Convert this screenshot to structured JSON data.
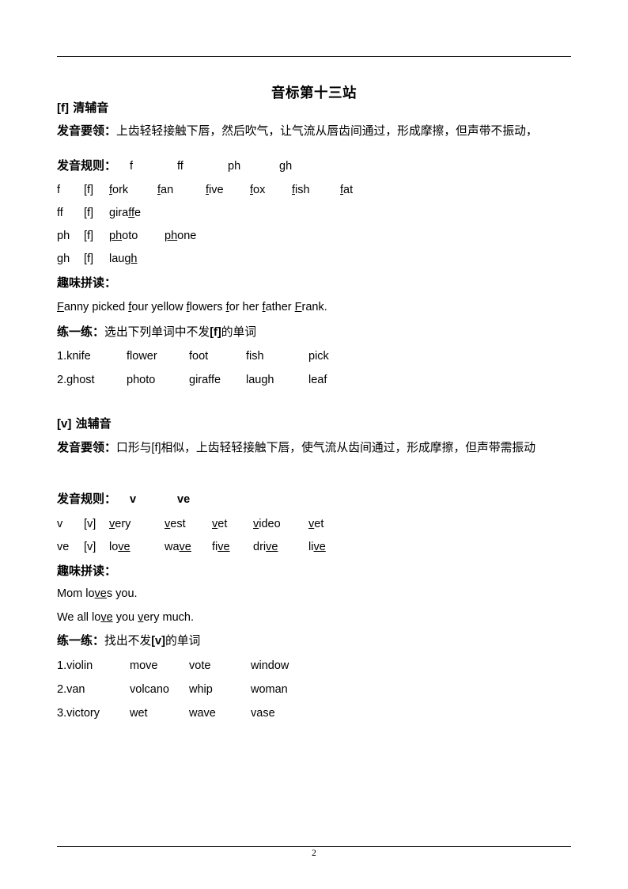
{
  "document": {
    "title": "音标第十三站",
    "page_number": "2"
  },
  "sections": [
    {
      "id": "f-section",
      "heading_ipa": "[f]",
      "heading_label": "清辅音",
      "key_label": "发音要领：",
      "key_text": "上齿轻轻接触下唇，然后吹气，让气流从唇齿间通过，形成摩擦，但声带不振动，",
      "rules_label": "发音规则：",
      "rule_letters": [
        "f",
        "ff",
        "ph",
        "gh"
      ],
      "word_rows": [
        {
          "spelling": "f",
          "ipa": "[f]",
          "words": [
            {
              "pre": "",
              "mark": "f",
              "post": "ork"
            },
            {
              "pre": "",
              "mark": "f",
              "post": "an"
            },
            {
              "pre": "",
              "mark": "f",
              "post": "ive"
            },
            {
              "pre": "",
              "mark": "f",
              "post": "ox"
            },
            {
              "pre": "",
              "mark": "f",
              "post": "ish"
            },
            {
              "pre": "",
              "mark": "f",
              "post": "at"
            }
          ]
        },
        {
          "spelling": "ff",
          "ipa": "[f]",
          "words": [
            {
              "pre": "gira",
              "mark": "ff",
              "post": "e"
            }
          ]
        },
        {
          "spelling": "ph",
          "ipa": "[f]",
          "words": [
            {
              "pre": "",
              "mark": "ph",
              "post": "oto"
            },
            {
              "pre": "",
              "mark": "ph",
              "post": "one"
            }
          ]
        },
        {
          "spelling": "gh",
          "ipa": "[f]",
          "words": [
            {
              "pre": "lau",
              "mark": "gh",
              "post": ""
            }
          ]
        }
      ],
      "fun_label": "趣味拼读：",
      "sentences": [
        [
          {
            "mark": "F",
            "post": "anny "
          },
          {
            "mark": "",
            "post": "picked "
          },
          {
            "mark": "f",
            "post": "our "
          },
          {
            "mark": "",
            "post": "yellow "
          },
          {
            "mark": "f",
            "post": "lowers "
          },
          {
            "mark": "f",
            "post": "or "
          },
          {
            "mark": "",
            "post": "her "
          },
          {
            "mark": "f",
            "post": "ather "
          },
          {
            "mark": "F",
            "post": "rank."
          }
        ]
      ],
      "practice_label": "练一练：",
      "practice_prompt_pre": "选出下列单词中不发",
      "practice_prompt_ipa": "[f]",
      "practice_prompt_post": "的单词",
      "practice_rows": [
        [
          "1.knife",
          "flower",
          "foot",
          "fish",
          "pick"
        ],
        [
          "2.ghost",
          "photo",
          "giraffe",
          "laugh",
          "leaf"
        ]
      ]
    },
    {
      "id": "v-section",
      "heading_ipa": "[v]",
      "heading_label": "浊辅音",
      "key_label": "发音要领：",
      "key_text_pre": "口形与",
      "key_text_ipa": "[f]",
      "key_text_post": "相似，上齿轻轻接触下唇，使气流从齿间通过，形成摩擦，但声带需振动",
      "rules_label": "发音规则：",
      "rule_letters": [
        "v",
        "ve"
      ],
      "word_rows": [
        {
          "spelling": "v",
          "ipa": "[v]",
          "words": [
            {
              "pre": "",
              "mark": "v",
              "post": "ery"
            },
            {
              "pre": "",
              "mark": "v",
              "post": "est"
            },
            {
              "pre": "",
              "mark": "v",
              "post": "et"
            },
            {
              "pre": "",
              "mark": "v",
              "post": "ideo"
            },
            {
              "pre": "",
              "mark": "v",
              "post": "et"
            }
          ]
        },
        {
          "spelling": "ve",
          "ipa": "[v]",
          "words": [
            {
              "pre": "lo",
              "mark": "ve",
              "post": ""
            },
            {
              "pre": "wa",
              "mark": "ve",
              "post": ""
            },
            {
              "pre": "fi",
              "mark": "ve",
              "post": ""
            },
            {
              "pre": "dri",
              "mark": "ve",
              "post": ""
            },
            {
              "pre": "li",
              "mark": "ve",
              "post": ""
            }
          ]
        }
      ],
      "fun_label": "趣味拼读：",
      "sentences": [
        [
          {
            "mark": "",
            "post": "Mom "
          },
          {
            "mark": "",
            "post": "lo"
          },
          {
            "mark": "ve",
            "post": "s "
          },
          {
            "mark": "",
            "post": "you."
          }
        ],
        [
          {
            "mark": "",
            "post": "We "
          },
          {
            "mark": "",
            "post": "all "
          },
          {
            "mark": "",
            "post": "lo"
          },
          {
            "mark": "ve",
            "post": " "
          },
          {
            "mark": "",
            "post": "you "
          },
          {
            "mark": "v",
            "post": "ery "
          },
          {
            "mark": "",
            "post": "much."
          }
        ]
      ],
      "practice_label": "练一练：",
      "practice_prompt_pre": "找出不发",
      "practice_prompt_ipa": "[v]",
      "practice_prompt_post": "的单词",
      "practice_rows": [
        [
          "1.violin",
          "move",
          "vote",
          "window"
        ],
        [
          "2.van",
          "volcano",
          "whip",
          "woman"
        ],
        [
          "3.victory",
          "wet",
          "wave",
          "vase"
        ]
      ]
    }
  ],
  "colors": {
    "text": "#000000",
    "background": "#ffffff",
    "rule": "#000000"
  }
}
